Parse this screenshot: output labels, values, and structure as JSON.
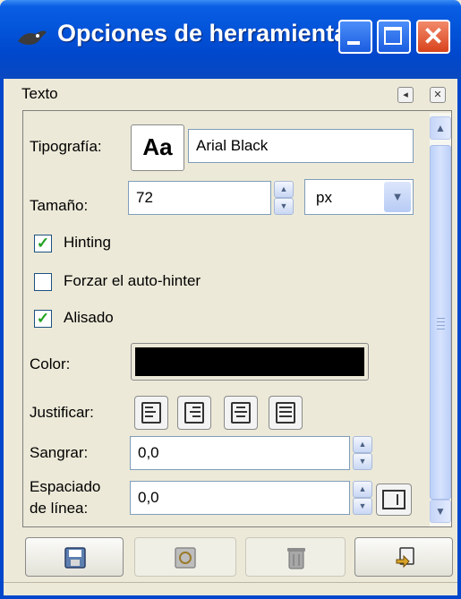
{
  "window": {
    "title": "Opciones de herramienta",
    "controls": [
      "minimize-icon",
      "maximize-icon",
      "close-icon"
    ],
    "close_glyph": "✕"
  },
  "dock": {
    "title": "Texto"
  },
  "text_options": {
    "font": {
      "label": "Tipografía:",
      "preview": "Aa",
      "value": "Arial Black"
    },
    "size": {
      "label": "Tamaño:",
      "value": "72",
      "unit": "px"
    },
    "hinting": {
      "label": "Hinting",
      "checked": true
    },
    "force_autohinter": {
      "label": "Forzar el auto-hinter",
      "checked": false
    },
    "antialias": {
      "label": "Alisado",
      "checked": true
    },
    "color": {
      "label": "Color:",
      "value": "#000000"
    },
    "justify": {
      "label": "Justificar:",
      "options": [
        "justify-left-icon",
        "justify-right-icon",
        "justify-center-icon",
        "justify-fill-icon"
      ]
    },
    "indent": {
      "label": "Sangrar:",
      "value": "0,0"
    },
    "line_spacing": {
      "label_line1": "Espaciado",
      "label_line2": "de línea:",
      "value": "0,0"
    }
  },
  "footer": {
    "buttons": [
      "save-icon",
      "restore-icon",
      "delete-icon",
      "reset-icon"
    ]
  },
  "colors": {
    "titlebar": "#0047cc",
    "face": "#ece9d8",
    "check": "#21a121"
  }
}
